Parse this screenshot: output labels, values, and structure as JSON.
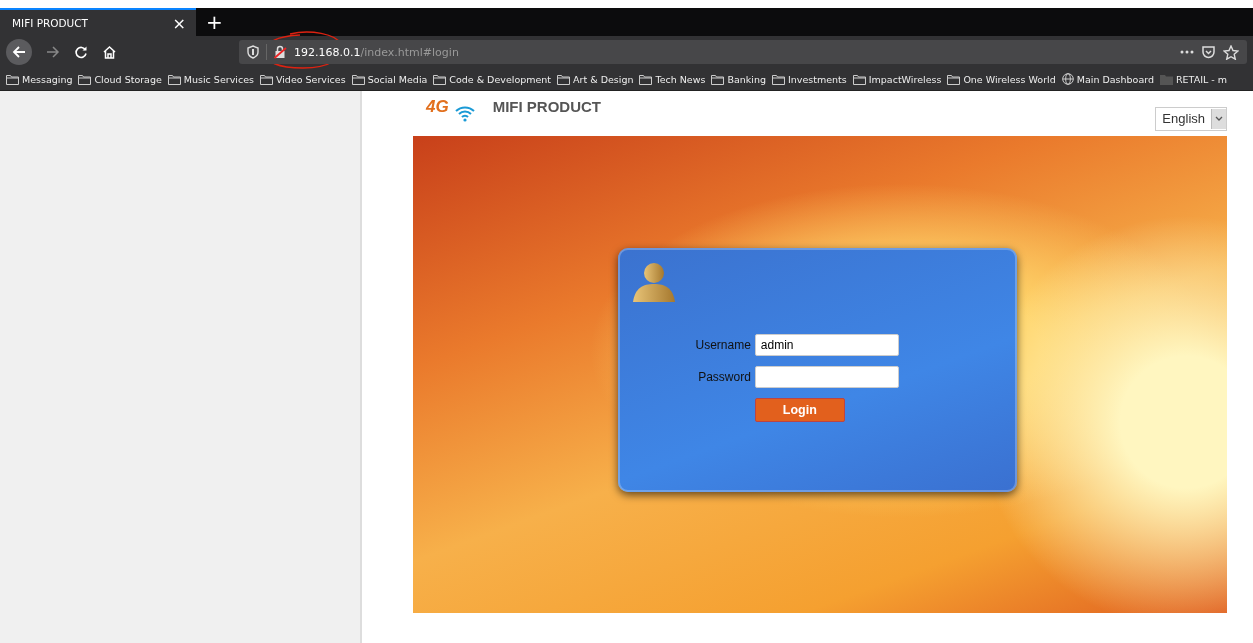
{
  "browser": {
    "tab": {
      "title": "MIFI PRODUCT",
      "close": "×",
      "selected": true
    },
    "new_tab": "+",
    "address": {
      "host": "192.168.0.1",
      "path": "/index.html#login"
    },
    "url_circled": true,
    "bookmarks": [
      {
        "label": "Messaging",
        "kind": "folder"
      },
      {
        "label": "Cloud Storage",
        "kind": "folder"
      },
      {
        "label": "Music Services",
        "kind": "folder"
      },
      {
        "label": "Video Services",
        "kind": "folder"
      },
      {
        "label": "Social Media",
        "kind": "folder"
      },
      {
        "label": "Code & Development",
        "kind": "folder"
      },
      {
        "label": "Art & Design",
        "kind": "folder"
      },
      {
        "label": "Tech News",
        "kind": "folder"
      },
      {
        "label": "Banking",
        "kind": "folder"
      },
      {
        "label": "Investments",
        "kind": "folder"
      },
      {
        "label": "ImpactWireless",
        "kind": "folder"
      },
      {
        "label": "One Wireless World",
        "kind": "folder"
      },
      {
        "label": "Main Dashboard",
        "kind": "globe"
      },
      {
        "label": "RETAIL - m",
        "kind": "filled-folder"
      }
    ]
  },
  "page": {
    "logo": "4G",
    "title": "MIFI PRODUCT",
    "language": "English",
    "login": {
      "username_label": "Username",
      "username": "admin",
      "password_label": "Password",
      "button": "Login"
    }
  }
}
